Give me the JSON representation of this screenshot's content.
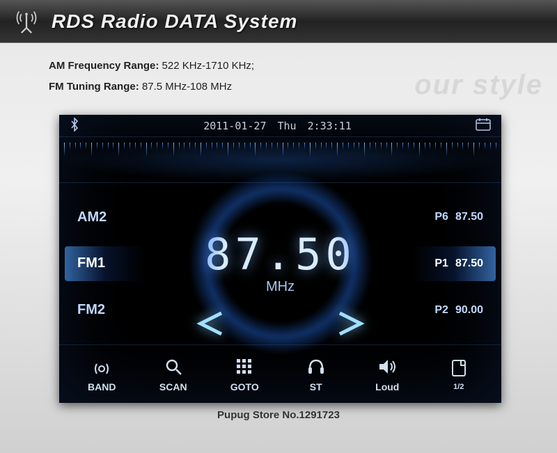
{
  "header": {
    "title": "RDS Radio DATA System"
  },
  "specs": {
    "am_label": "AM Frequency Range:",
    "am_value": "522 KHz-1710 KHz;",
    "fm_label": "FM Tuning Range:",
    "fm_value": "87.5 MHz-108 MHz"
  },
  "watermark": "our style",
  "status": {
    "date": "2011-01-27",
    "day": "Thu",
    "time": "2:33:11"
  },
  "bands": [
    {
      "label": "AM2",
      "active": false
    },
    {
      "label": "FM1",
      "active": true
    },
    {
      "label": "FM2",
      "active": false
    }
  ],
  "frequency": {
    "value": "87.50",
    "unit": "MHz"
  },
  "presets": [
    {
      "slot": "P6",
      "freq": "87.50",
      "active": false
    },
    {
      "slot": "P1",
      "freq": "87.50",
      "active": true
    },
    {
      "slot": "P2",
      "freq": "90.00",
      "active": false
    }
  ],
  "bottom": [
    {
      "label": "BAND"
    },
    {
      "label": "SCAN"
    },
    {
      "label": "GOTO"
    },
    {
      "label": "ST"
    },
    {
      "label": "Loud"
    },
    {
      "label": "1/2"
    }
  ],
  "footer": "Pupug Store No.1291723"
}
